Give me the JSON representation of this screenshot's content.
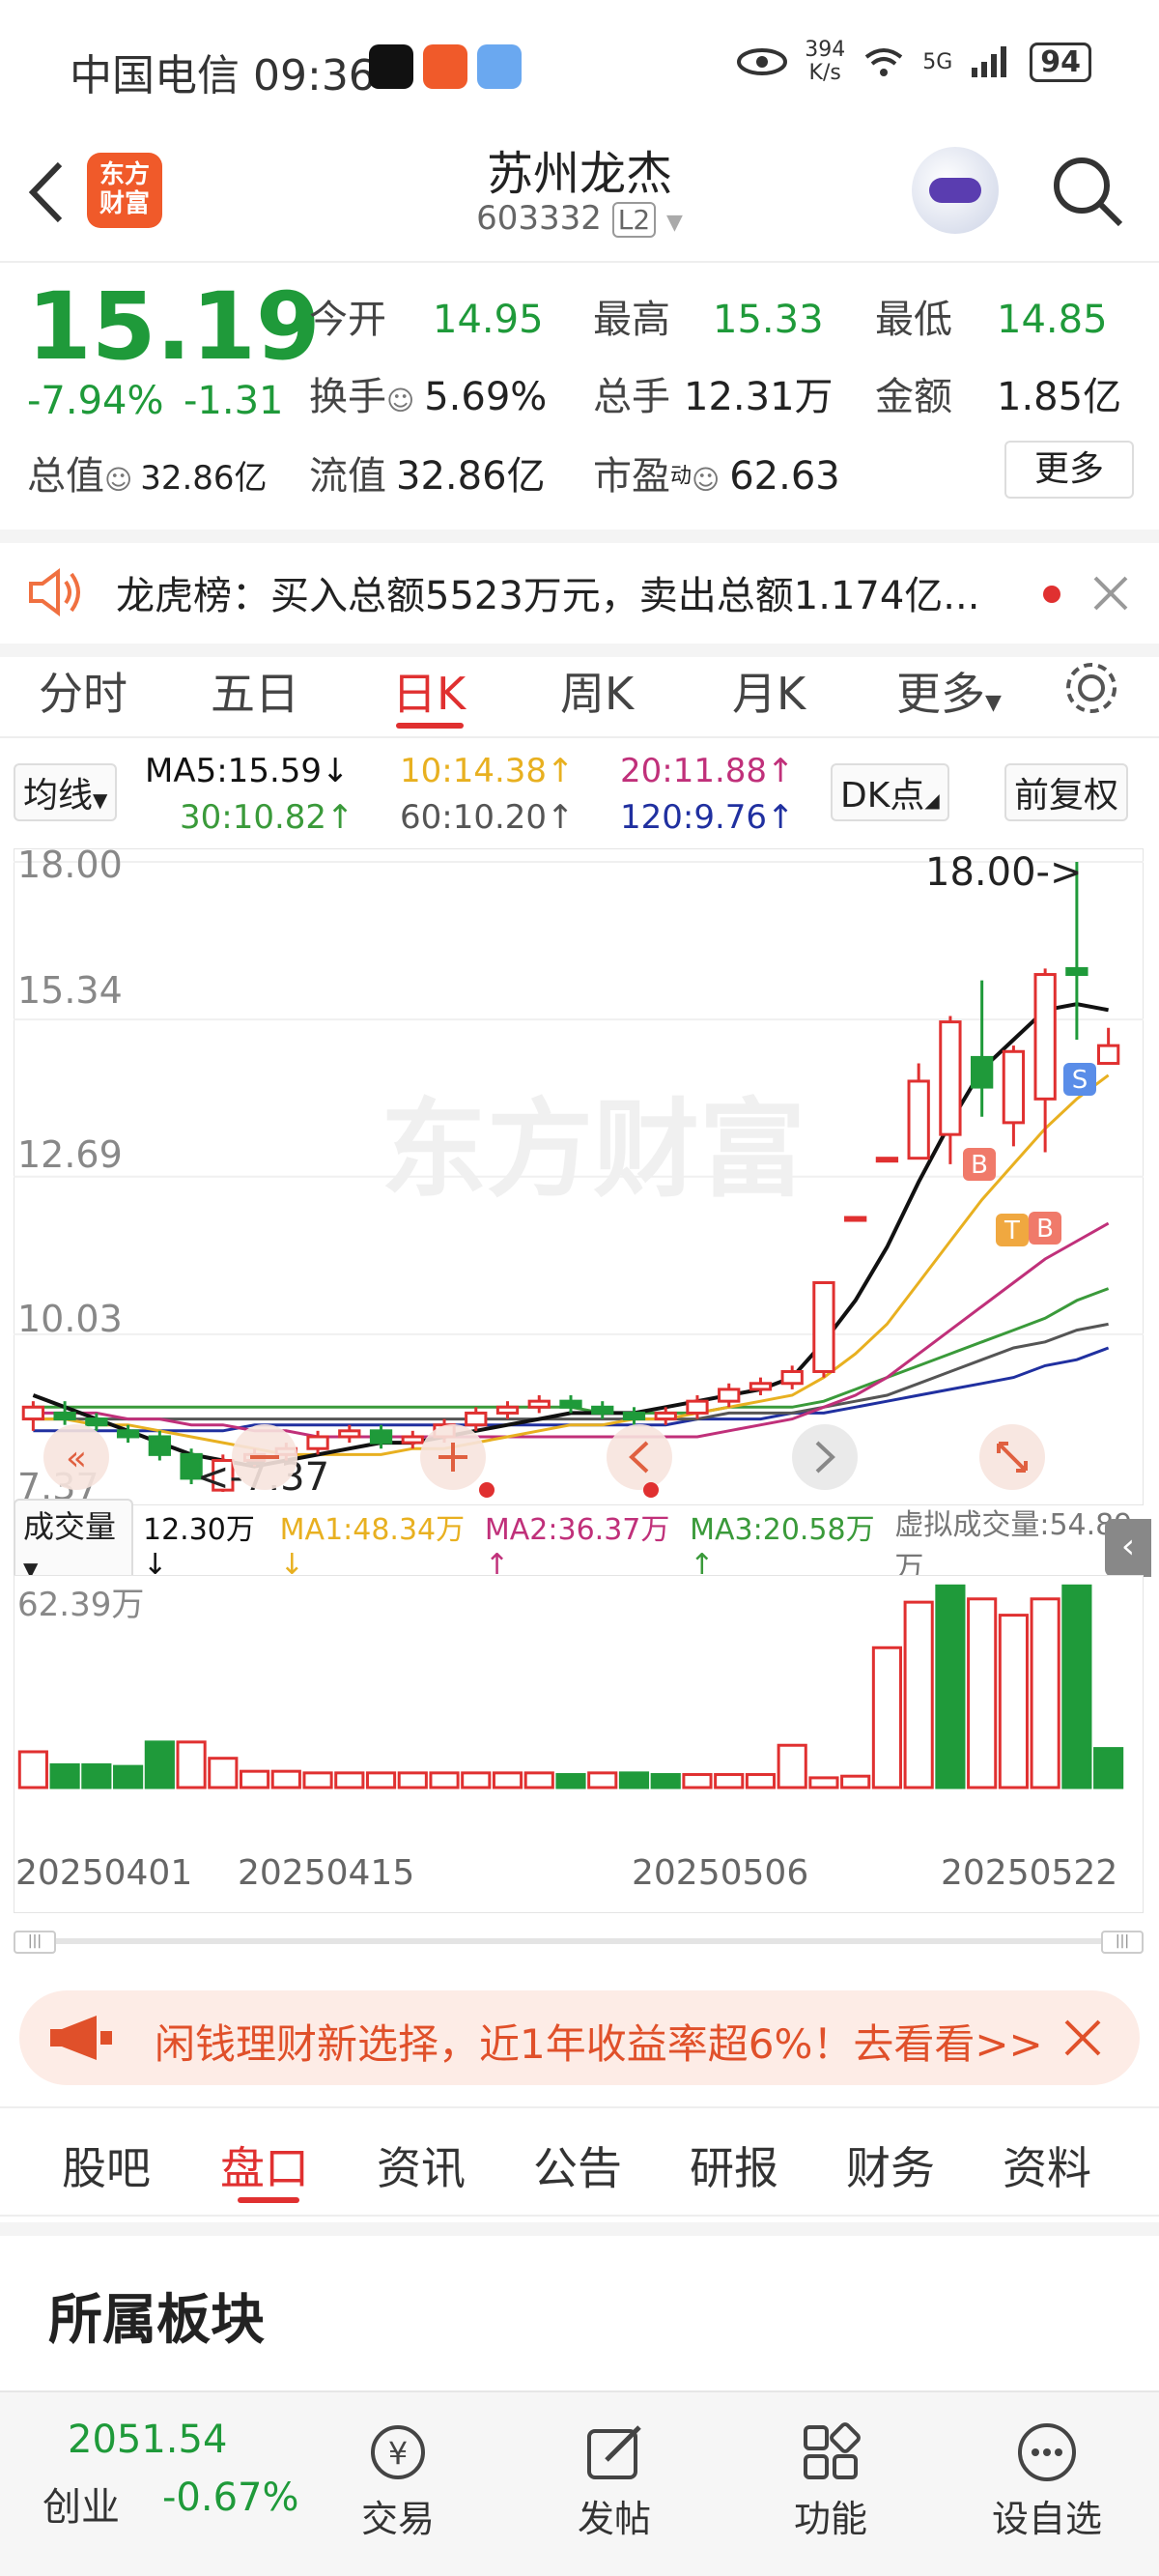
{
  "status_bar": {
    "carrier": "中国电信",
    "time": "09:36",
    "net_speed_value": "394",
    "net_speed_unit": "K/s",
    "signal": "5G",
    "battery": "94"
  },
  "header": {
    "logo_text_1": "东方",
    "logo_text_2": "财富",
    "stock_name": "苏州龙杰",
    "stock_code": "603332",
    "level_badge": "L2"
  },
  "quote": {
    "price": "15.19",
    "change_pct": "-7.94%",
    "change": "-1.31",
    "open_label": "今开",
    "open": "14.95",
    "high_label": "最高",
    "high": "15.33",
    "low_label": "最低",
    "low": "14.85",
    "turnover_label": "换手",
    "turnover": "5.69%",
    "volume_label": "总手",
    "volume": "12.31万",
    "amount_label": "金额",
    "amount": "1.85亿",
    "mktcap_label": "总值",
    "mktcap": "32.86亿",
    "float_label": "流值",
    "float_cap": "32.86亿",
    "pe_label": "市盈",
    "pe_sup": "动",
    "pe": "62.63",
    "more_label": "更多"
  },
  "notice": {
    "text": "龙虎榜：买入总额5523万元，卖出总额1.174亿..."
  },
  "chart_tabs": [
    "分时",
    "五日",
    "日K",
    "周K",
    "月K",
    "更多"
  ],
  "chart_tab_active": 2,
  "ma_row": {
    "select_label": "均线",
    "ma5": "MA5:15.59↓",
    "ma10": "10:14.38↑",
    "ma20": "20:11.88↑",
    "ma30": "30:10.82↑",
    "ma60": "60:10.20↑",
    "ma120": "120:9.76↑",
    "dk_label": "DK点",
    "adjust_label": "前复权"
  },
  "colors": {
    "up": "#e03030",
    "down": "#1f9a3a",
    "ma5": "#111111",
    "ma10": "#e8b020",
    "ma20": "#c0307a",
    "ma30": "#3a9a3a",
    "ma60": "#555555",
    "ma120": "#2030a0"
  },
  "chart_labels": {
    "y_ticks": [
      "18.00",
      "15.34",
      "12.69",
      "10.03",
      "7.37"
    ],
    "high_marker": "18.00->",
    "low_marker": "<-7.37",
    "watermark": "东方财富",
    "signal_b": "B",
    "signal_t": "T",
    "signal_s": "S"
  },
  "chart_data": {
    "type": "candlestick",
    "ylim": [
      7.37,
      18.0
    ],
    "candles": [
      {
        "o": 8.6,
        "c": 8.8,
        "h": 8.9,
        "l": 8.4
      },
      {
        "o": 8.7,
        "c": 8.6,
        "h": 8.9,
        "l": 8.5
      },
      {
        "o": 8.6,
        "c": 8.5,
        "h": 8.7,
        "l": 8.4
      },
      {
        "o": 8.4,
        "c": 8.3,
        "h": 8.5,
        "l": 8.2
      },
      {
        "o": 8.3,
        "c": 8.0,
        "h": 8.4,
        "l": 7.9
      },
      {
        "o": 8.0,
        "c": 7.6,
        "h": 8.1,
        "l": 7.5
      },
      {
        "o": 7.4,
        "c": 7.9,
        "h": 8.0,
        "l": 7.37
      },
      {
        "o": 7.9,
        "c": 8.0,
        "h": 8.1,
        "l": 7.8
      },
      {
        "o": 8.0,
        "c": 8.1,
        "h": 8.2,
        "l": 7.9
      },
      {
        "o": 8.1,
        "c": 8.3,
        "h": 8.4,
        "l": 8.0
      },
      {
        "o": 8.3,
        "c": 8.4,
        "h": 8.5,
        "l": 8.2
      },
      {
        "o": 8.4,
        "c": 8.2,
        "h": 8.5,
        "l": 8.1
      },
      {
        "o": 8.2,
        "c": 8.3,
        "h": 8.4,
        "l": 8.1
      },
      {
        "o": 8.3,
        "c": 8.5,
        "h": 8.6,
        "l": 8.2
      },
      {
        "o": 8.5,
        "c": 8.7,
        "h": 8.8,
        "l": 8.4
      },
      {
        "o": 8.7,
        "c": 8.8,
        "h": 8.9,
        "l": 8.6
      },
      {
        "o": 8.8,
        "c": 8.9,
        "h": 9.0,
        "l": 8.7
      },
      {
        "o": 8.9,
        "c": 8.8,
        "h": 9.0,
        "l": 8.7
      },
      {
        "o": 8.8,
        "c": 8.7,
        "h": 8.9,
        "l": 8.6
      },
      {
        "o": 8.7,
        "c": 8.6,
        "h": 8.8,
        "l": 8.5
      },
      {
        "o": 8.6,
        "c": 8.7,
        "h": 8.8,
        "l": 8.5
      },
      {
        "o": 8.7,
        "c": 8.9,
        "h": 9.0,
        "l": 8.6
      },
      {
        "o": 8.9,
        "c": 9.1,
        "h": 9.2,
        "l": 8.8
      },
      {
        "o": 9.1,
        "c": 9.2,
        "h": 9.3,
        "l": 9.0
      },
      {
        "o": 9.2,
        "c": 9.4,
        "h": 9.5,
        "l": 9.1
      },
      {
        "o": 9.4,
        "c": 10.9,
        "h": 10.9,
        "l": 9.3
      },
      {
        "o": 12.0,
        "c": 12.0,
        "h": 12.0,
        "l": 12.0
      },
      {
        "o": 13.0,
        "c": 13.0,
        "h": 13.0,
        "l": 13.0
      },
      {
        "o": 13.0,
        "c": 14.3,
        "h": 14.6,
        "l": 13.0
      },
      {
        "o": 13.4,
        "c": 15.3,
        "h": 15.4,
        "l": 12.9
      },
      {
        "o": 14.7,
        "c": 14.2,
        "h": 16.0,
        "l": 13.7
      },
      {
        "o": 13.6,
        "c": 14.8,
        "h": 14.9,
        "l": 13.2
      },
      {
        "o": 14.0,
        "c": 16.1,
        "h": 16.2,
        "l": 13.1
      },
      {
        "o": 16.2,
        "c": 16.1,
        "h": 18.0,
        "l": 15.0
      },
      {
        "o": 14.6,
        "c": 14.9,
        "h": 15.2,
        "l": 14.6
      }
    ],
    "ma5": [
      9.0,
      8.8,
      8.6,
      8.4,
      8.2,
      8.0,
      7.9,
      7.8,
      7.9,
      8.0,
      8.1,
      8.2,
      8.2,
      8.3,
      8.4,
      8.5,
      8.6,
      8.7,
      8.7,
      8.7,
      8.8,
      8.9,
      9.0,
      9.1,
      9.3,
      9.9,
      10.6,
      11.5,
      12.6,
      13.6,
      14.5,
      15.0,
      15.5,
      15.6,
      15.5
    ],
    "ma10": [
      8.6,
      8.6,
      8.5,
      8.5,
      8.4,
      8.3,
      8.2,
      8.1,
      8.0,
      8.0,
      8.0,
      8.0,
      8.1,
      8.1,
      8.2,
      8.3,
      8.4,
      8.5,
      8.5,
      8.6,
      8.6,
      8.7,
      8.8,
      8.9,
      9.0,
      9.3,
      9.7,
      10.2,
      10.9,
      11.6,
      12.3,
      12.9,
      13.5,
      14.0,
      14.4
    ],
    "ma20": [
      8.7,
      8.7,
      8.7,
      8.6,
      8.6,
      8.5,
      8.5,
      8.4,
      8.4,
      8.3,
      8.3,
      8.3,
      8.3,
      8.3,
      8.3,
      8.3,
      8.3,
      8.3,
      8.3,
      8.3,
      8.3,
      8.3,
      8.4,
      8.5,
      8.6,
      8.8,
      9.0,
      9.3,
      9.7,
      10.1,
      10.5,
      10.9,
      11.3,
      11.6,
      11.9
    ],
    "ma30": [
      8.8,
      8.8,
      8.8,
      8.8,
      8.8,
      8.8,
      8.8,
      8.8,
      8.8,
      8.8,
      8.8,
      8.8,
      8.8,
      8.8,
      8.8,
      8.8,
      8.8,
      8.8,
      8.7,
      8.7,
      8.7,
      8.7,
      8.8,
      8.8,
      8.8,
      8.9,
      9.1,
      9.3,
      9.5,
      9.7,
      9.9,
      10.1,
      10.3,
      10.6,
      10.8
    ],
    "ma60": [
      8.6,
      8.6,
      8.6,
      8.6,
      8.6,
      8.6,
      8.6,
      8.6,
      8.6,
      8.6,
      8.6,
      8.6,
      8.6,
      8.6,
      8.6,
      8.6,
      8.6,
      8.6,
      8.6,
      8.6,
      8.6,
      8.6,
      8.7,
      8.7,
      8.7,
      8.8,
      8.9,
      9.0,
      9.2,
      9.4,
      9.6,
      9.8,
      9.9,
      10.1,
      10.2
    ],
    "ma120": [
      8.4,
      8.4,
      8.4,
      8.4,
      8.4,
      8.4,
      8.4,
      8.5,
      8.5,
      8.5,
      8.5,
      8.5,
      8.5,
      8.5,
      8.5,
      8.5,
      8.5,
      8.5,
      8.5,
      8.5,
      8.5,
      8.6,
      8.6,
      8.6,
      8.7,
      8.7,
      8.8,
      8.9,
      9.0,
      9.1,
      9.2,
      9.3,
      9.5,
      9.6,
      9.8
    ],
    "volumes": [
      11.0,
      7.0,
      7.0,
      6.5,
      14.0,
      14.0,
      9.0,
      5.0,
      5.0,
      4.5,
      4.5,
      4.5,
      4.5,
      4.5,
      4.5,
      4.5,
      4.5,
      4.0,
      4.5,
      4.5,
      4.0,
      4.0,
      4.0,
      4.0,
      13.0,
      3.0,
      3.5,
      43.0,
      57.0,
      62.0,
      58.0,
      53.0,
      58.0,
      62.0,
      12.0
    ],
    "vol_up": [
      true,
      false,
      false,
      false,
      false,
      true,
      true,
      true,
      true,
      true,
      true,
      true,
      true,
      true,
      true,
      true,
      true,
      false,
      true,
      false,
      false,
      true,
      true,
      true,
      true,
      true,
      true,
      true,
      true,
      false,
      true,
      true,
      true,
      false,
      false
    ],
    "x_ticks": [
      "20250401",
      "20250415",
      "20250506",
      "20250522"
    ]
  },
  "volume_row": {
    "select_label": "成交量",
    "vol": "12.30万↓",
    "ma1": "MA1:48.34万↓",
    "ma2": "MA2:36.37万↑",
    "ma3": "MA3:20.58万↑",
    "virtual": "虚拟成交量:54.89万",
    "max_label": "62.39万"
  },
  "banner": {
    "text": "闲钱理财新选择，近1年收益率超6%！去看看>>"
  },
  "info_tabs": [
    "股吧",
    "盘口",
    "资讯",
    "公告",
    "研报",
    "财务",
    "资料"
  ],
  "info_tab_active": 1,
  "section": {
    "title": "所属板块"
  },
  "bottom_nav": {
    "index_value": "2051.54",
    "index_name": "创业",
    "index_change": "-0.67%",
    "trade": "交易",
    "post": "发帖",
    "features": "功能",
    "watch": "设自选"
  }
}
